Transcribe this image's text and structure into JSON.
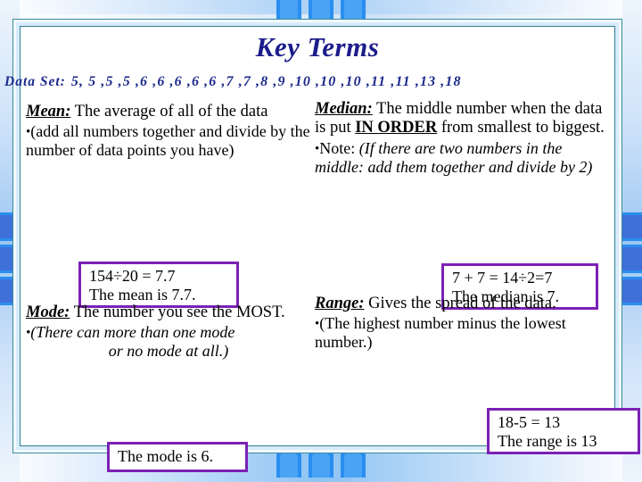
{
  "slide": {
    "title": "Key Terms",
    "accent_purple": "#7b21b5",
    "title_color": "#1c1c8c",
    "frame_color": "#2f8193",
    "chevron_color": "#2a8ef0"
  },
  "data_set": {
    "label": "Data Set:",
    "values_text": "5, 5 ,5 ,5 ,6 ,6 ,6 ,6 ,6 ,7 ,7 ,8 ,9 ,10 ,10 ,10 ,11 ,11 ,13 ,18",
    "values": [
      5,
      5,
      5,
      5,
      6,
      6,
      6,
      6,
      6,
      7,
      7,
      8,
      9,
      10,
      10,
      10,
      11,
      11,
      13,
      18
    ]
  },
  "terms": {
    "mean": {
      "name": "Mean:",
      "definition": "The average of all of the data",
      "bullet": "(add all numbers together and divide by the number of data points you have)",
      "answer_line1": "154÷20 = 7.7",
      "answer_line2": "The mean is 7.7."
    },
    "median": {
      "name": "Median:",
      "definition_part1": "The middle number when the data is put ",
      "definition_emphasis": "IN ORDER",
      "definition_part2": " from smallest to biggest.",
      "bullet_label": "Note:",
      "bullet_italic": "(If there are two numbers in the middle:  add them together and divide by 2)",
      "answer_line1": "7 + 7 = 14÷2=7",
      "answer_line2": "The median is 7."
    },
    "mode": {
      "name": "Mode:",
      "definition": "The number you see the MOST.",
      "bullet_line1": "(There can more than one mode",
      "bullet_line2": "or no mode at all.)",
      "answer_line1": "The mode is 6."
    },
    "range": {
      "name": "Range:",
      "definition": "Gives the spread of the data.",
      "bullet": "(The highest number minus the lowest number.)",
      "answer_line1": "18-5 = 13",
      "answer_line2": "The range is  13"
    }
  }
}
